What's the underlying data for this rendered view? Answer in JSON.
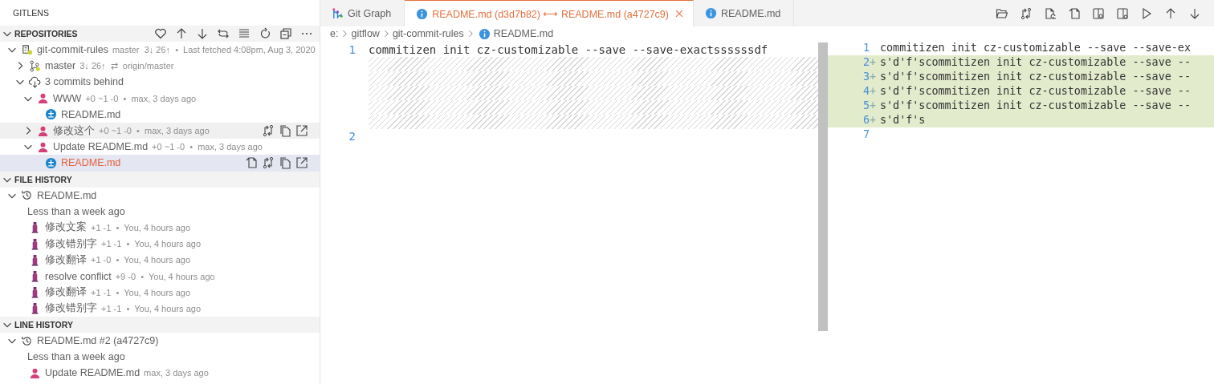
{
  "sidebar": {
    "title": "GITLENS",
    "sections": [
      {
        "kind": "repositories",
        "title": "REPOSITORIES",
        "expanded": true,
        "rows": [
          {
            "kind": "repo",
            "label": "git-commit-rules",
            "description": "master  3↓ 26↑  •  Last fetched 4:08pm, Aug 3, 2020",
            "expanded": true,
            "selected": false,
            "hovered": false,
            "children": [
              {
                "kind": "branch",
                "label": "master",
                "description": "3↓ 26↑  ⇄  origin/master",
                "expanded": false,
                "selected": false,
                "hovered": false
              },
              {
                "kind": "behind",
                "label": "3 commits behind",
                "expanded": true,
                "selected": false,
                "hovered": false,
                "children": [
                  {
                    "kind": "commit",
                    "label": "WWW",
                    "description": "+0 ~1 -0  •  max, 3 days ago",
                    "expanded": true,
                    "selected": false,
                    "hovered": false,
                    "children": [
                      {
                        "kind": "file",
                        "label": "README.md",
                        "modified": false,
                        "selected": false,
                        "hovered": false
                      }
                    ]
                  },
                  {
                    "kind": "commit",
                    "label": "修改这个",
                    "description": "+0 ~1 -0  •  max, 3 days ago",
                    "expanded": false,
                    "selected": false,
                    "hovered": true
                  },
                  {
                    "kind": "commit",
                    "label": "Update README.md",
                    "description": "+0 ~1 -0  •  max, 3 days ago",
                    "expanded": true,
                    "selected": false,
                    "hovered": false,
                    "children": [
                      {
                        "kind": "file",
                        "label": "README.md",
                        "modified": true,
                        "selected": true,
                        "hovered": false
                      }
                    ]
                  }
                ]
              }
            ]
          }
        ]
      },
      {
        "kind": "file-history",
        "title": "FILE HISTORY",
        "expanded": true,
        "rows": [
          {
            "kind": "history",
            "label": "README.md",
            "expanded": true,
            "selected": false,
            "hovered": false,
            "children": [
              {
                "kind": "group",
                "label": "Less than a week ago",
                "selected": false,
                "hovered": false
              },
              {
                "kind": "revision",
                "label": "修改文案",
                "description": "+1 -1  •  You, 4 hours ago",
                "selected": false,
                "hovered": false
              },
              {
                "kind": "revision",
                "label": "修改错别字",
                "description": "+1 -1  •  You, 4 hours ago",
                "selected": false,
                "hovered": false
              },
              {
                "kind": "revision",
                "label": "修改翻译",
                "description": "+1 -0  •  You, 4 hours ago",
                "selected": false,
                "hovered": false
              },
              {
                "kind": "revision",
                "label": "resolve conflict",
                "description": "+9 -0  •  You, 4 hours ago",
                "selected": false,
                "hovered": false
              },
              {
                "kind": "revision",
                "label": "修改翻译",
                "description": "+1 -1  •  You, 4 hours ago",
                "selected": false,
                "hovered": false
              },
              {
                "kind": "revision",
                "label": "修改错别字",
                "description": "+1 -1  •  You, 4 hours ago",
                "selected": false,
                "hovered": false
              }
            ]
          }
        ]
      },
      {
        "kind": "line-history",
        "title": "LINE HISTORY",
        "expanded": true,
        "rows": [
          {
            "kind": "history",
            "label": "README.md #2 (a4727c9)",
            "expanded": true,
            "selected": false,
            "hovered": false,
            "children": [
              {
                "kind": "group",
                "label": "Less than a week ago",
                "selected": false,
                "hovered": false
              },
              {
                "kind": "commit",
                "label": "Update README.md",
                "description": "max, 3 days ago",
                "selected": false,
                "hovered": false
              }
            ]
          }
        ]
      }
    ]
  },
  "editor": {
    "tabs": [
      {
        "kind": "graph",
        "label": "Git Graph",
        "selected": false
      },
      {
        "kind": "diff",
        "label": "README.md (d3d7b82) ⟷ README.md (a4727c9)",
        "selected": true
      },
      {
        "kind": "file",
        "label": "README.md",
        "selected": false
      }
    ],
    "breadcrumb": [
      "e:",
      "gitflow",
      "git-commit-rules",
      "README.md"
    ],
    "left_pane": {
      "lines": [
        {
          "kind": "line",
          "number": "1",
          "text": "commitizen init cz-customizable --save --save-exactssssssdf"
        },
        {
          "kind": "placeholder"
        },
        {
          "kind": "placeholder"
        },
        {
          "kind": "placeholder"
        },
        {
          "kind": "placeholder"
        },
        {
          "kind": "placeholder"
        },
        {
          "kind": "line",
          "number": "2"
        }
      ]
    },
    "right_pane": {
      "lines": [
        {
          "kind": "line",
          "number": "1",
          "text": "commitizen init cz-customizable --save --save-ex"
        },
        {
          "kind": "added",
          "number": "2",
          "marker": "+",
          "text": "s'd'f'scommitizen init cz-customizable --save --"
        },
        {
          "kind": "added",
          "number": "3",
          "marker": "+",
          "text": "s'd'f'scommitizen init cz-customizable --save --"
        },
        {
          "kind": "added",
          "number": "4",
          "marker": "+",
          "text": "s'd'f'scommitizen init cz-customizable --save --"
        },
        {
          "kind": "added",
          "number": "5",
          "marker": "+",
          "text": "s'd'f'scommitizen init cz-customizable --save --"
        },
        {
          "kind": "added",
          "number": "6",
          "marker": "+",
          "text": "s'd'f's"
        },
        {
          "kind": "line",
          "number": "7"
        }
      ]
    }
  }
}
